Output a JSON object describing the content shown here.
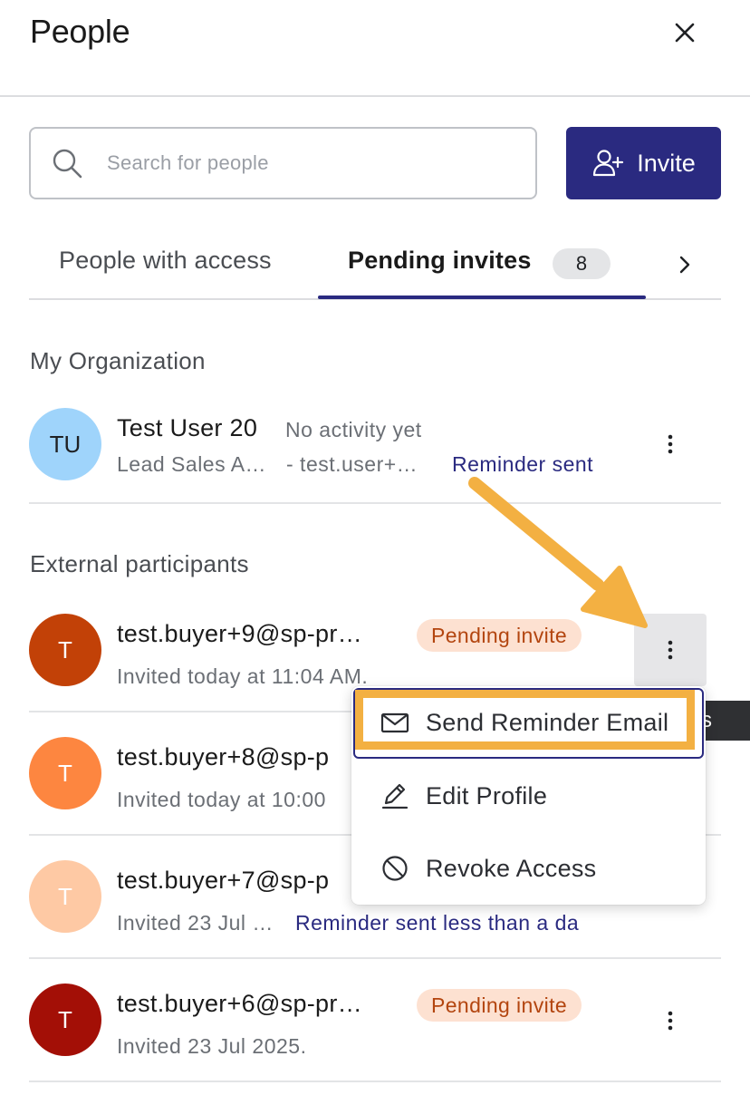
{
  "header": {
    "title": "People",
    "close_icon": "close-icon"
  },
  "search": {
    "placeholder": "Search for people",
    "value": "",
    "icon": "search-icon"
  },
  "invite_button": {
    "label": "Invite",
    "icon": "add-person-icon",
    "color": "#2a2a80"
  },
  "tabs": [
    {
      "label": "People with access",
      "active": false
    },
    {
      "label": "Pending invites",
      "active": true,
      "count": "8"
    }
  ],
  "tabs_next_icon": "chevron-right-icon",
  "sections": {
    "my_org": {
      "title": "My Organization",
      "rows": [
        {
          "initials": "TU",
          "avatar_color": "#9fd4fb",
          "name": "Test User 20",
          "activity": "No activity yet",
          "subtitle": "Lead Sales A…",
          "email": "- test.user+…",
          "status_link": "Reminder sent"
        }
      ]
    },
    "external": {
      "title": "External participants",
      "rows": [
        {
          "initials": "T",
          "avatar_color": "#c24107",
          "name": "test.buyer+9@sp-pr…",
          "badge": "Pending invite",
          "subtitle": "Invited today at 11:04 AM."
        },
        {
          "initials": "T",
          "avatar_color": "#fd8640",
          "name": "test.buyer+8@sp-p",
          "subtitle": "Invited today at 10:00"
        },
        {
          "initials": "T",
          "avatar_color": "#fec9a4",
          "name": "test.buyer+7@sp-p",
          "subtitle": "Invited 23 Jul …",
          "status_link": "Reminder sent less than a da"
        },
        {
          "initials": "T",
          "avatar_color": "#a30f06",
          "name": "test.buyer+6@sp-pr…",
          "badge": "Pending invite",
          "subtitle": "Invited 23 Jul 2025."
        }
      ]
    }
  },
  "context_menu": {
    "items": [
      {
        "label": "Send Reminder Email",
        "icon": "envelope-icon",
        "highlighted": true
      },
      {
        "label": "Edit Profile",
        "icon": "pencil-icon"
      },
      {
        "label": "Revoke Access",
        "icon": "block-icon"
      }
    ],
    "tooltip_fragment": "s"
  },
  "annotation": {
    "arrow_color": "#f3b042"
  }
}
